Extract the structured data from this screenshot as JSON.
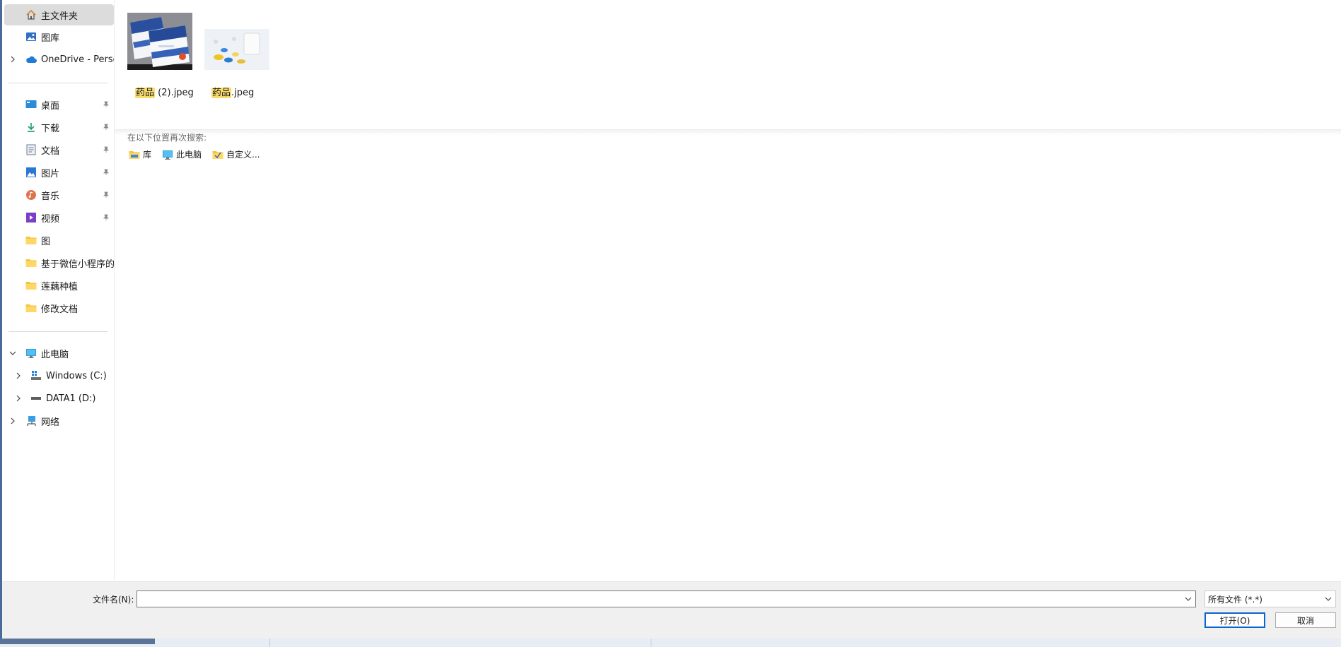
{
  "sidebar": {
    "quick": [
      {
        "name": "nav-home",
        "label": "主文件夹",
        "icon": "home-icon"
      },
      {
        "name": "nav-gallery",
        "label": "图库",
        "icon": "gallery-icon"
      },
      {
        "name": "nav-onedrive",
        "label": "OneDrive - Perso",
        "icon": "cloud-icon"
      }
    ],
    "pinned": [
      {
        "name": "nav-desktop",
        "label": "桌面",
        "icon": "desktop-icon"
      },
      {
        "name": "nav-downloads",
        "label": "下载",
        "icon": "download-icon"
      },
      {
        "name": "nav-documents",
        "label": "文档",
        "icon": "document-icon"
      },
      {
        "name": "nav-pictures",
        "label": "图片",
        "icon": "pictures-icon"
      },
      {
        "name": "nav-music",
        "label": "音乐",
        "icon": "music-icon"
      },
      {
        "name": "nav-videos",
        "label": "视频",
        "icon": "video-icon"
      },
      {
        "name": "nav-folder-tu",
        "label": "图",
        "icon": "folder-icon"
      },
      {
        "name": "nav-folder-wechat",
        "label": "基于微信小程序的药",
        "icon": "folder-icon"
      },
      {
        "name": "nav-folder-lotus",
        "label": "莲藕种植",
        "icon": "folder-icon"
      },
      {
        "name": "nav-folder-edit",
        "label": "修改文档",
        "icon": "folder-icon"
      }
    ],
    "computer": [
      {
        "name": "nav-this-pc",
        "label": "此电脑",
        "icon": "computer-icon"
      },
      {
        "name": "nav-drive-c",
        "label": "Windows (C:)",
        "icon": "windows-drive-icon"
      },
      {
        "name": "nav-drive-d",
        "label": "DATA1 (D:)",
        "icon": "drive-icon"
      },
      {
        "name": "nav-network",
        "label": "网络",
        "icon": "network-icon"
      }
    ]
  },
  "results": {
    "files": [
      {
        "highlight": "药品",
        "rest": " (2).jpeg"
      },
      {
        "highlight": "药品",
        "rest": ".jpeg"
      }
    ],
    "search_again_label": "在以下位置再次搜索:",
    "locations": [
      {
        "label": "库",
        "icon": "library-folder-icon"
      },
      {
        "label": "此电脑",
        "icon": "computer-icon"
      },
      {
        "label": "自定义...",
        "icon": "custom-folder-icon"
      }
    ]
  },
  "footer": {
    "filename_label": "文件名(N):",
    "filename_value": "",
    "filetype_value": "所有文件 (*.*)",
    "open_label": "打开(O)",
    "cancel_label": "取消"
  },
  "colors": {
    "accent": "#0a64d2",
    "highlight": "#f9dc6b",
    "folder": "#f5c542",
    "progress": "#5b7398"
  }
}
